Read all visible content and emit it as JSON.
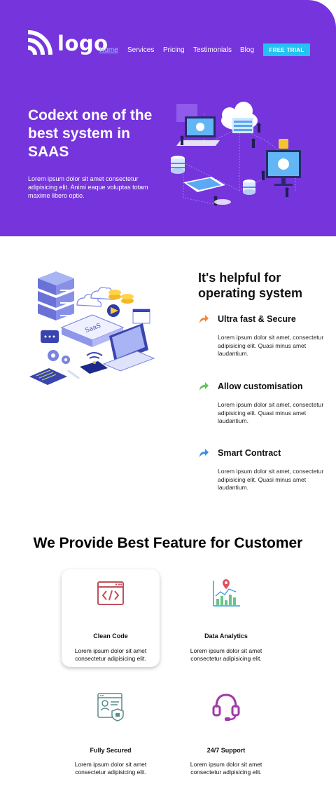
{
  "header": {
    "logo_text": "logo",
    "nav": [
      "Home",
      "Services",
      "Pricing",
      "Testimonials",
      "Blog"
    ],
    "cta": "FREE TRIAL"
  },
  "hero": {
    "title": "Codext one of the best system in SAAS",
    "text": "Lorem ipsum dolor sit amet consectetur adipisicing elit. Animi eaque voluptas totam maxime libero optio."
  },
  "helpful": {
    "title": "It's helpful for operating system",
    "illustration_label": "SaaS",
    "features": [
      {
        "title": "Ultra fast & Secure",
        "desc": "Lorem ipsum dolor sit amet, consectetur adipisicing elit. Quasi minus amet laudantium.",
        "color": "#f08a3c"
      },
      {
        "title": "Allow customisation",
        "desc": "Lorem ipsum dolor sit amet, consectetur adipisicing elit. Quasi minus amet laudantium.",
        "color": "#5cc95a"
      },
      {
        "title": "Smart Contract",
        "desc": "Lorem ipsum dolor sit amet, consectetur adipisicing elit. Quasi minus amet laudantium.",
        "color": "#3a8ee8"
      }
    ]
  },
  "provide": {
    "title": "We Provide Best Feature for Customer",
    "cards": [
      {
        "icon": "code-window-icon",
        "title": "Clean Code",
        "desc": "Lorem ipsum dolor sit amet consectetur adipisicing elit."
      },
      {
        "icon": "data-analytics-icon",
        "title": "Data Analytics",
        "desc": "Lorem ipsum dolor sit amet consectetur adipisicing elit."
      },
      {
        "icon": "secured-profile-icon",
        "title": "Fully Secured",
        "desc": "Lorem ipsum dolor sit amet consectetur adipisicing elit."
      },
      {
        "icon": "headset-support-icon",
        "title": "24/7 Support",
        "desc": "Lorem ipsum dolor sit amet consectetur adipisicing elit."
      }
    ]
  },
  "colors": {
    "brand_purple": "#7534dc",
    "cta_blue": "#22c3f0",
    "nav_active": "#9fc8ff"
  }
}
